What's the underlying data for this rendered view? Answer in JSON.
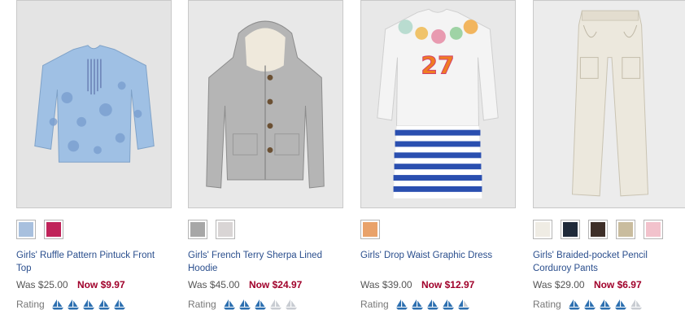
{
  "products": [
    {
      "name": "Girls' Ruffle Pattern Pintuck Front Top",
      "was": "Was $25.00",
      "now": "Now $9.97",
      "rating_label": "Rating",
      "rating": 5,
      "swatches": [
        "#a8c0de",
        "#c0245a"
      ]
    },
    {
      "name": "Girls' French Terry Sherpa Lined Hoodie",
      "was": "Was $45.00",
      "now": "Now $24.97",
      "rating_label": "Rating",
      "rating": 3,
      "swatches": [
        "#a7a7a7",
        "#d9d5d5"
      ]
    },
    {
      "name": "Girls' Drop Waist Graphic Dress",
      "was": "Was $39.00",
      "now": "Now $12.97",
      "rating_label": "Rating",
      "rating": 4.5,
      "swatches": [
        "#e9a26a"
      ]
    },
    {
      "name": "Girls' Braided-pocket Pencil Corduroy Pants",
      "was": "Was $29.00",
      "now": "Now $6.97",
      "rating_label": "Rating",
      "rating": 4,
      "swatches": [
        "#efece4",
        "#1f2a3a",
        "#3e2f28",
        "#c9bc9e",
        "#f2c2cc"
      ]
    }
  ],
  "colors": {
    "link": "#2a4e8d",
    "sale": "#a0002a",
    "rating_on": "#2c6fb0",
    "rating_off": "#c8ccd2"
  }
}
